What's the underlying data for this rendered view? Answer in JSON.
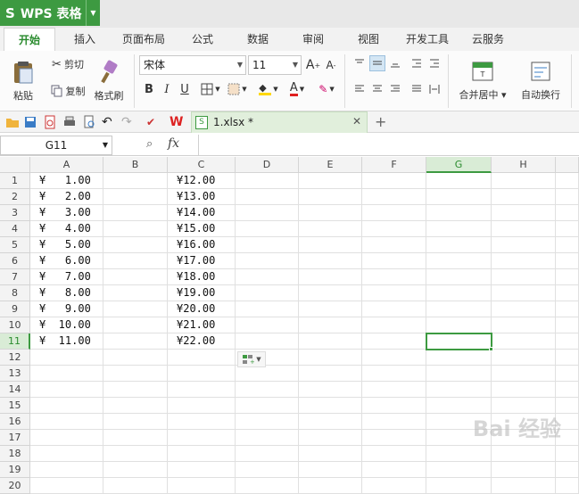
{
  "app": {
    "logo": "S",
    "title": "WPS 表格"
  },
  "tabs": [
    {
      "label": "开始",
      "active": true
    },
    {
      "label": "插入"
    },
    {
      "label": "页面布局"
    },
    {
      "label": "公式"
    },
    {
      "label": "数据"
    },
    {
      "label": "审阅"
    },
    {
      "label": "视图"
    },
    {
      "label": "开发工具"
    },
    {
      "label": "云服务"
    }
  ],
  "ribbon": {
    "paste": "粘贴",
    "cut": "剪切",
    "copy": "复制",
    "format_painter": "格式刷",
    "font_name": "宋体",
    "font_size": "11",
    "bold": "B",
    "italic": "I",
    "underline": "U",
    "merge_center": "合并居中",
    "wrap_text": "自动换行"
  },
  "doc_tab": {
    "name": "1.xlsx *"
  },
  "formula_bar": {
    "name_box": "G11",
    "fx": "fx"
  },
  "columns": [
    "A",
    "B",
    "C",
    "D",
    "E",
    "F",
    "G",
    "H"
  ],
  "active_column": "G",
  "rows": [
    {
      "num": "1",
      "a": "¥   1.00",
      "c": "¥12.00"
    },
    {
      "num": "2",
      "a": "¥   2.00",
      "c": "¥13.00"
    },
    {
      "num": "3",
      "a": "¥   3.00",
      "c": "¥14.00"
    },
    {
      "num": "4",
      "a": "¥   4.00",
      "c": "¥15.00"
    },
    {
      "num": "5",
      "a": "¥   5.00",
      "c": "¥16.00"
    },
    {
      "num": "6",
      "a": "¥   6.00",
      "c": "¥17.00"
    },
    {
      "num": "7",
      "a": "¥   7.00",
      "c": "¥18.00"
    },
    {
      "num": "8",
      "a": "¥   8.00",
      "c": "¥19.00"
    },
    {
      "num": "9",
      "a": "¥   9.00",
      "c": "¥20.00"
    },
    {
      "num": "10",
      "a": "¥  10.00",
      "c": "¥21.00"
    },
    {
      "num": "11",
      "a": "¥  11.00",
      "c": "¥22.00"
    },
    {
      "num": "12",
      "a": "",
      "c": ""
    },
    {
      "num": "13",
      "a": "",
      "c": ""
    },
    {
      "num": "14",
      "a": "",
      "c": ""
    },
    {
      "num": "15",
      "a": "",
      "c": ""
    },
    {
      "num": "16",
      "a": "",
      "c": ""
    },
    {
      "num": "17",
      "a": "",
      "c": ""
    },
    {
      "num": "18",
      "a": "",
      "c": ""
    },
    {
      "num": "19",
      "a": "",
      "c": ""
    },
    {
      "num": "20",
      "a": "",
      "c": ""
    }
  ],
  "active_row": "11",
  "watermark": "Bai 经验",
  "colors": {
    "accent": "#3d9a41",
    "active_header": "#d9ecd6"
  }
}
